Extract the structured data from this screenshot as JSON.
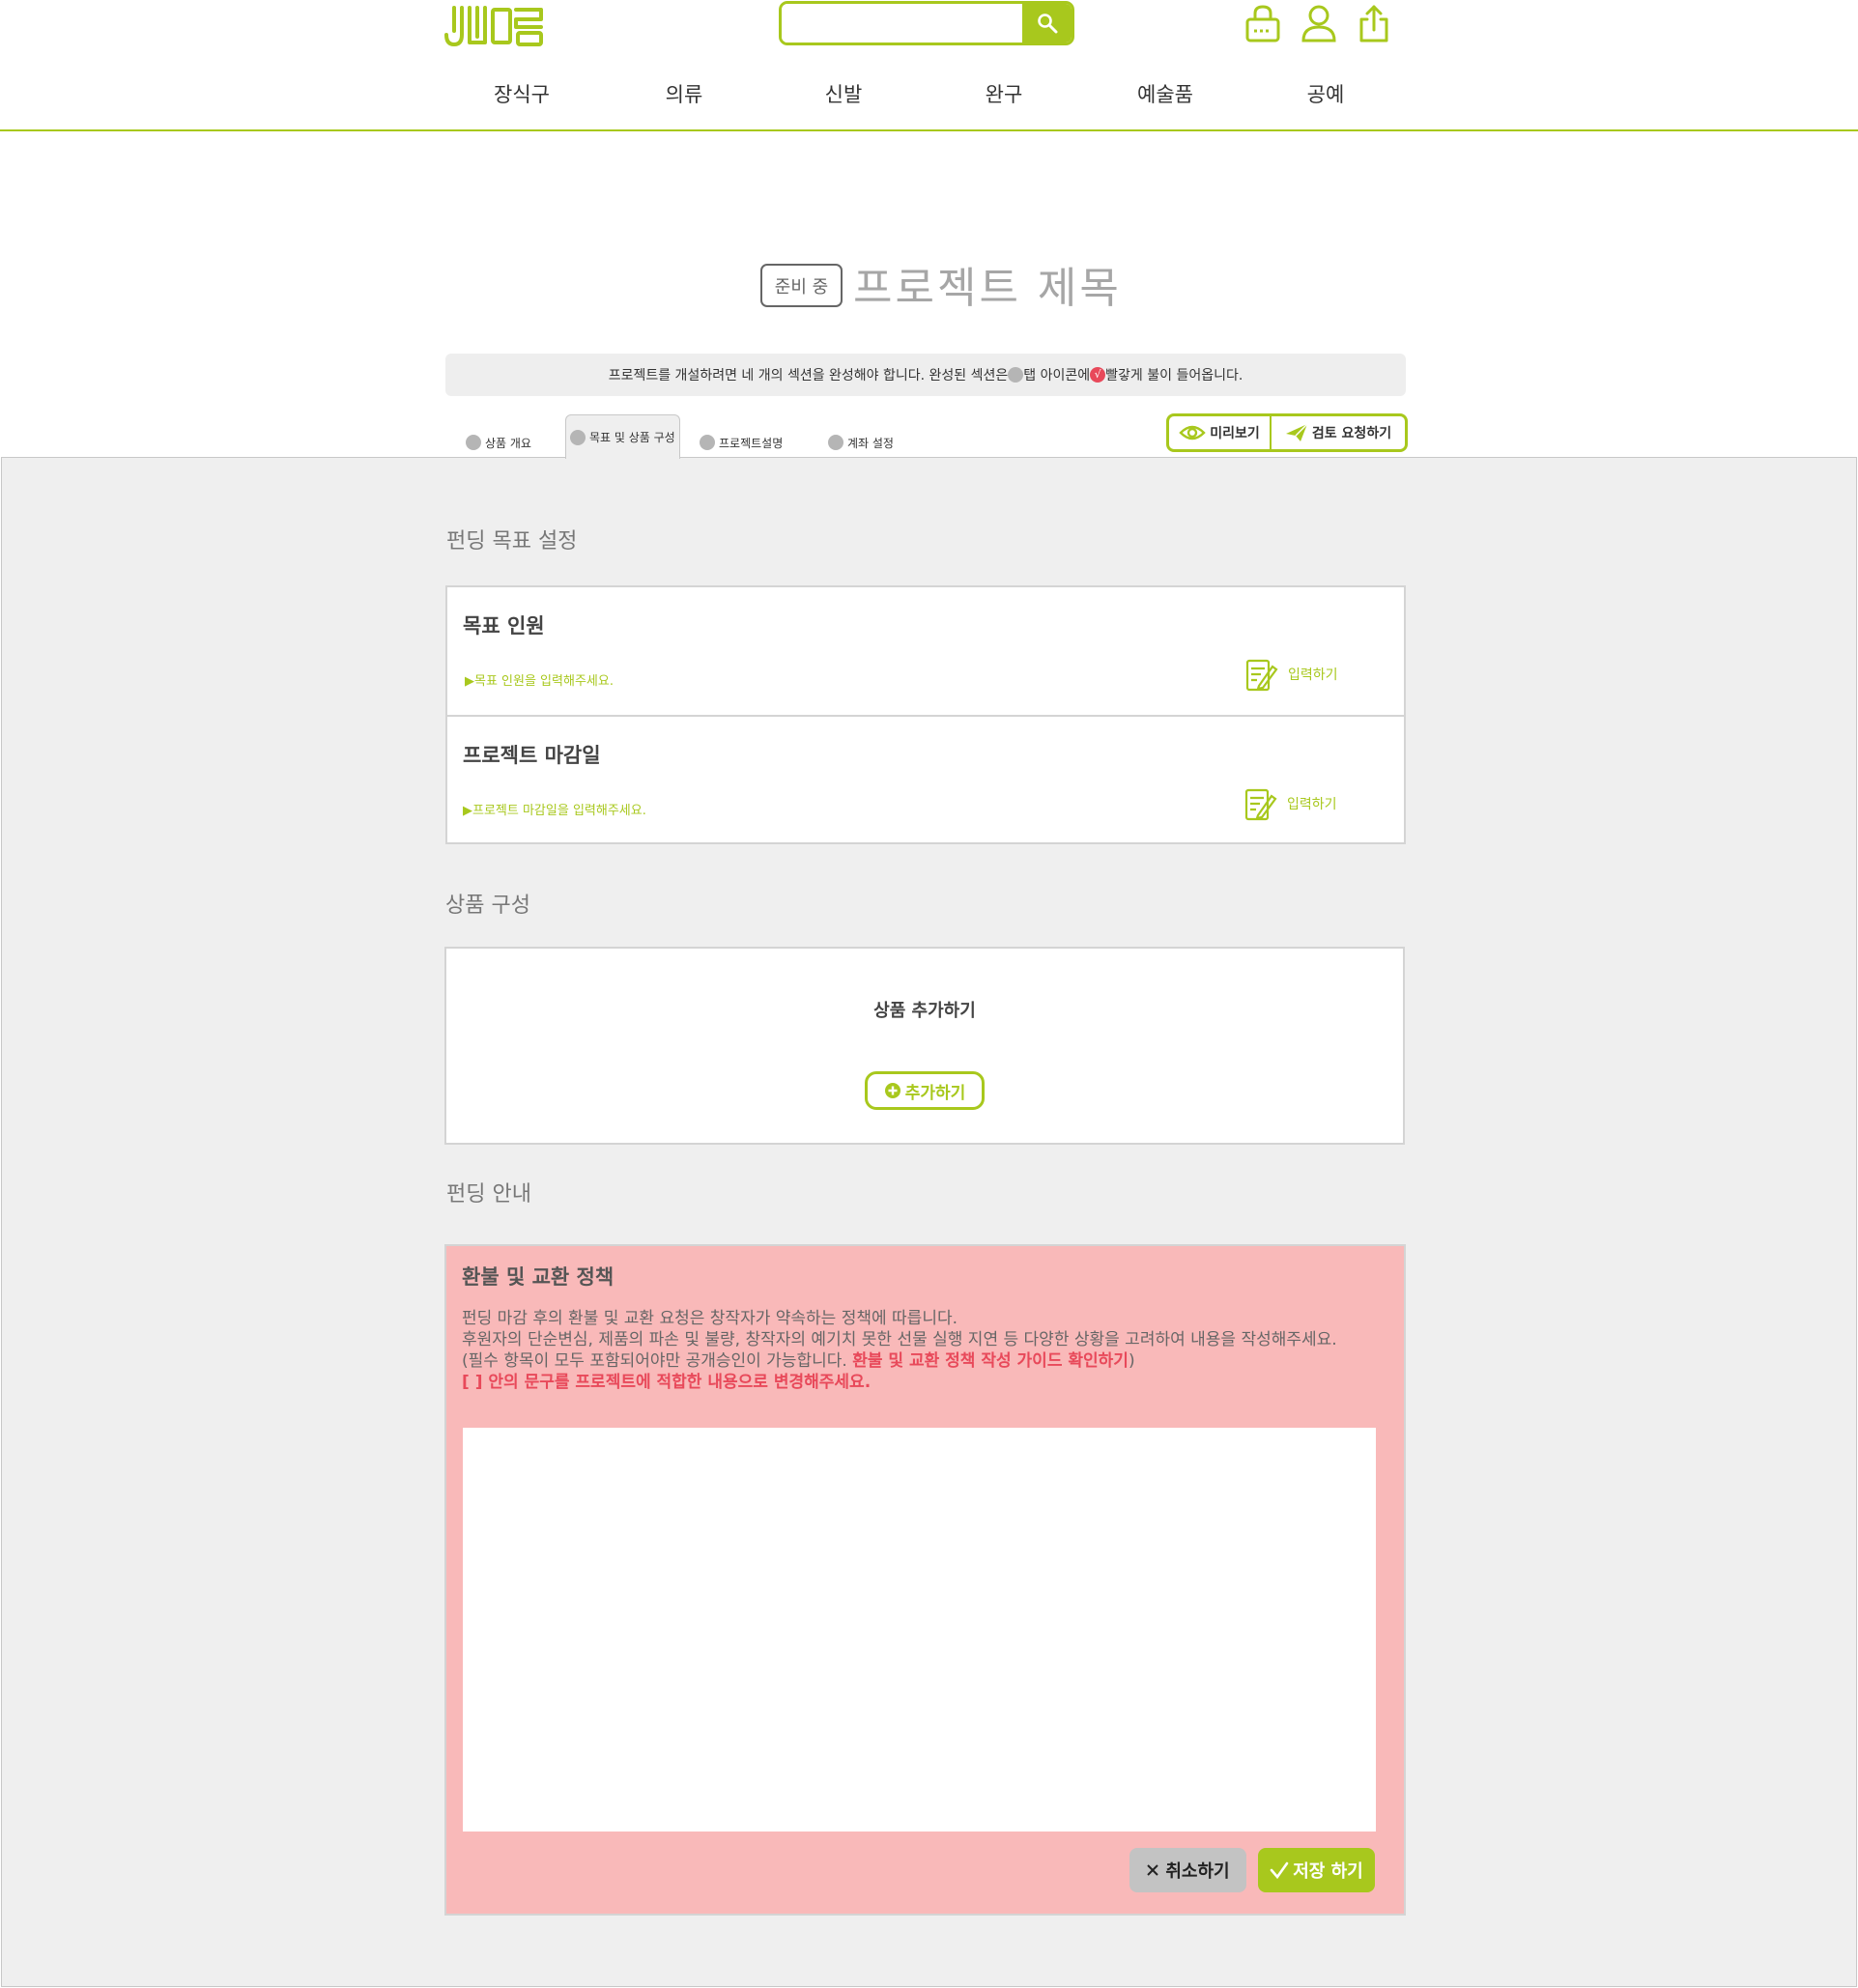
{
  "header": {
    "logo_text": "새마음",
    "search_placeholder": "",
    "icons": [
      "cart-icon",
      "user-icon",
      "share-icon"
    ]
  },
  "nav": {
    "items": [
      {
        "label": "장식구"
      },
      {
        "label": "의류"
      },
      {
        "label": "신발"
      },
      {
        "label": "완구"
      },
      {
        "label": "예술품"
      },
      {
        "label": "공예"
      }
    ]
  },
  "project": {
    "status": "준비 중",
    "title": "프로젝트 제목"
  },
  "notice": {
    "part1": "프로젝트를 개설하려면 네 개의 섹션을 완성해야 합니다. 완성된 섹션은",
    "part2": " 탭 아이콘에 ",
    "check_mark": "√",
    "part3": "빨갛게 불이 들어옵니다."
  },
  "tabs": [
    {
      "label": "상품 개요"
    },
    {
      "label": "목표 및 상품 구성"
    },
    {
      "label": "프로젝트설명"
    },
    {
      "label": "계좌 설정"
    }
  ],
  "actions": {
    "preview": "미리보기",
    "review": "검토 요청하기"
  },
  "funding_goal": {
    "section_title": "펀딩 목표 설정",
    "rows": [
      {
        "title": "목표 인원",
        "hint": "▶목표 인원을 입력해주세요.",
        "action": "입력하기"
      },
      {
        "title": "프로젝트 마감일",
        "hint": "▶프로젝트 마감일을 입력해주세요.",
        "action": "입력하기"
      }
    ]
  },
  "products": {
    "section_title": "상품 구성",
    "label": "상품 추가하기",
    "add_button": "추가하기"
  },
  "guide": {
    "section_title": "펀딩 안내",
    "policy_title": "환불 및 교환 정책",
    "line1": "펀딩 마감 후의 환불 및 교환 요청은 창작자가 약속하는 정책에 따릅니다.",
    "line2": "후원자의 단순변심, 제품의 파손 및 불량, 창작자의 예기치 못한 선물 실행 지연 등 다양한 상황을 고려하여 내용을 작성해주세요.",
    "line3_a": "(필수 항목이 모두 포함되어야만 공개승인이 가능합니다.",
    "line3_link": "환불 및 교환 정책 작성 가이드 확인하기",
    "line3_b": ")",
    "line4": "[    ] 안의 문구를 프로젝트에 적합한 내용으로 변경해주세요.",
    "textarea_value": "",
    "cancel": "취소하기",
    "save": "저장 하기"
  },
  "colors": {
    "accent": "#a8c81d",
    "panel_bg": "#efefef",
    "policy_bg": "#f9b9b9",
    "highlight_red": "#e8495a"
  }
}
